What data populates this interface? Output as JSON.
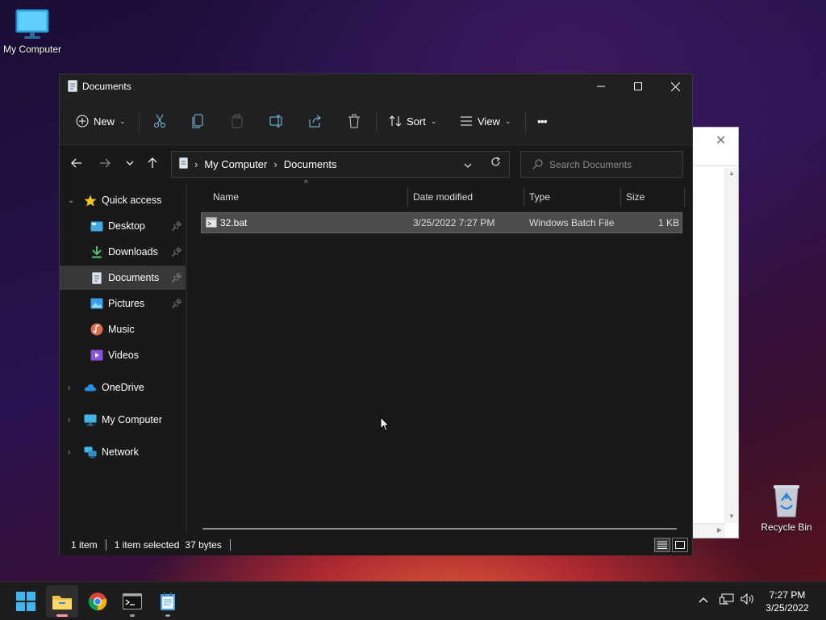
{
  "desktop": {
    "icons": [
      {
        "label": "My Computer"
      },
      {
        "label": "Recycle Bin"
      }
    ]
  },
  "window": {
    "title": "Documents",
    "toolbar": {
      "new_label": "New",
      "sort_label": "Sort",
      "view_label": "View",
      "more_label": "•••"
    },
    "address": {
      "crumbs": [
        "My Computer",
        "Documents"
      ]
    },
    "search": {
      "placeholder": "Search Documents"
    },
    "sidebar": {
      "quick_access": "Quick access",
      "items": [
        {
          "label": "Desktop",
          "icon": "desktop-icon",
          "pinned": true
        },
        {
          "label": "Downloads",
          "icon": "download-icon",
          "pinned": true
        },
        {
          "label": "Documents",
          "icon": "document-icon",
          "pinned": true,
          "selected": true
        },
        {
          "label": "Pictures",
          "icon": "picture-icon",
          "pinned": true
        },
        {
          "label": "Music",
          "icon": "music-icon",
          "pinned": false
        },
        {
          "label": "Videos",
          "icon": "video-icon",
          "pinned": false
        }
      ],
      "roots": [
        {
          "label": "OneDrive",
          "icon": "cloud-icon"
        },
        {
          "label": "My Computer",
          "icon": "computer-icon"
        },
        {
          "label": "Network",
          "icon": "network-icon"
        }
      ]
    },
    "columns": [
      "Name",
      "Date modified",
      "Type",
      "Size"
    ],
    "files": [
      {
        "name": "32.bat",
        "date": "3/25/2022 7:27 PM",
        "type": "Windows Batch File",
        "size": "1 KB",
        "selected": true
      }
    ],
    "status": {
      "count": "1 item",
      "selection": "1 item selected",
      "size": "37 bytes"
    }
  },
  "taskbar": {
    "apps": [
      "start-icon",
      "file-explorer-icon",
      "chrome-icon",
      "terminal-icon",
      "notepad-icon"
    ],
    "active_app": "file-explorer-icon",
    "time": "7:27 PM",
    "date": "3/25/2022"
  },
  "colors": {
    "window_bg": "#191919",
    "selection": "#4d4d4d",
    "accent": "#60cdff"
  }
}
